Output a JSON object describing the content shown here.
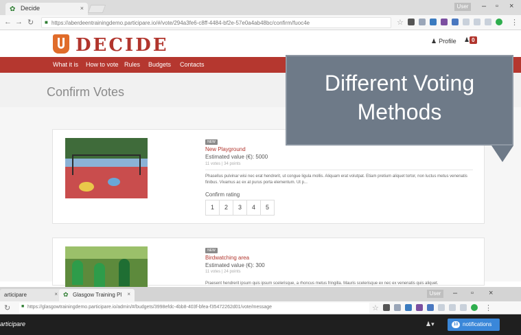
{
  "browser_top": {
    "tab_title": "Decide",
    "url": "https://aberdeentrainingdemo.participare.io/#/vote/294a3fe6-c8ff-4484-bf2e-57e0a4ab48bc/confirm/fuoc4e",
    "user_chip": "User"
  },
  "site": {
    "logo": "DECIDE",
    "profile_label": "Profile",
    "notification_count": "0",
    "nav": [
      "What it is",
      "How to vote",
      "Rules",
      "Budgets",
      "Contacts"
    ],
    "page_title": "Confirm Votes"
  },
  "projects": [
    {
      "tag": "NEW",
      "name": "New Playground",
      "value": "Estimated value (€): 5000",
      "votes": "11 votes | 34 points",
      "description": "Phasellus pulvinar wisi nec erat hendrerit, ut congue ligula mollis. Aliquam erat volutpat. Etiam pretium aliquet tortor, non luctus metus venenatis finibus. Vivamus ac ex at purus porta elementum. Ut p...",
      "rating_label": "Confirm rating",
      "ratings": [
        "1",
        "2",
        "3",
        "4",
        "5"
      ]
    },
    {
      "tag": "NEW",
      "name": "Birdwatching area",
      "value": "Estimated value (€): 300",
      "votes": "11 votes | 24 points",
      "description": "Praesent hendrerit ipsum quis ipsum scelerisque, a rhoncus metus fringilla. Mauris scelerisque ex nec ex venenatis quis aliquet."
    }
  ],
  "callout": {
    "line1": "Different Voting",
    "line2": "Methods"
  },
  "browser_bottom": {
    "tab_a": "articipare",
    "tab_b": "Glasgow Training Pl",
    "url": "https://glasgowtrainingdemo.participare.io/admin/#/budgets/3998efdc-4bb8-403f-bfea-f35472262d01/vote/message",
    "user_chip": "User",
    "brand": "articipare",
    "notif_count": "10",
    "notif_label": "notifications"
  },
  "colors": {
    "brand_red": "#b5372f",
    "logo_orange": "#e06c2a",
    "callout_bg": "#6e7a88",
    "notif_blue": "#3a87d9"
  }
}
